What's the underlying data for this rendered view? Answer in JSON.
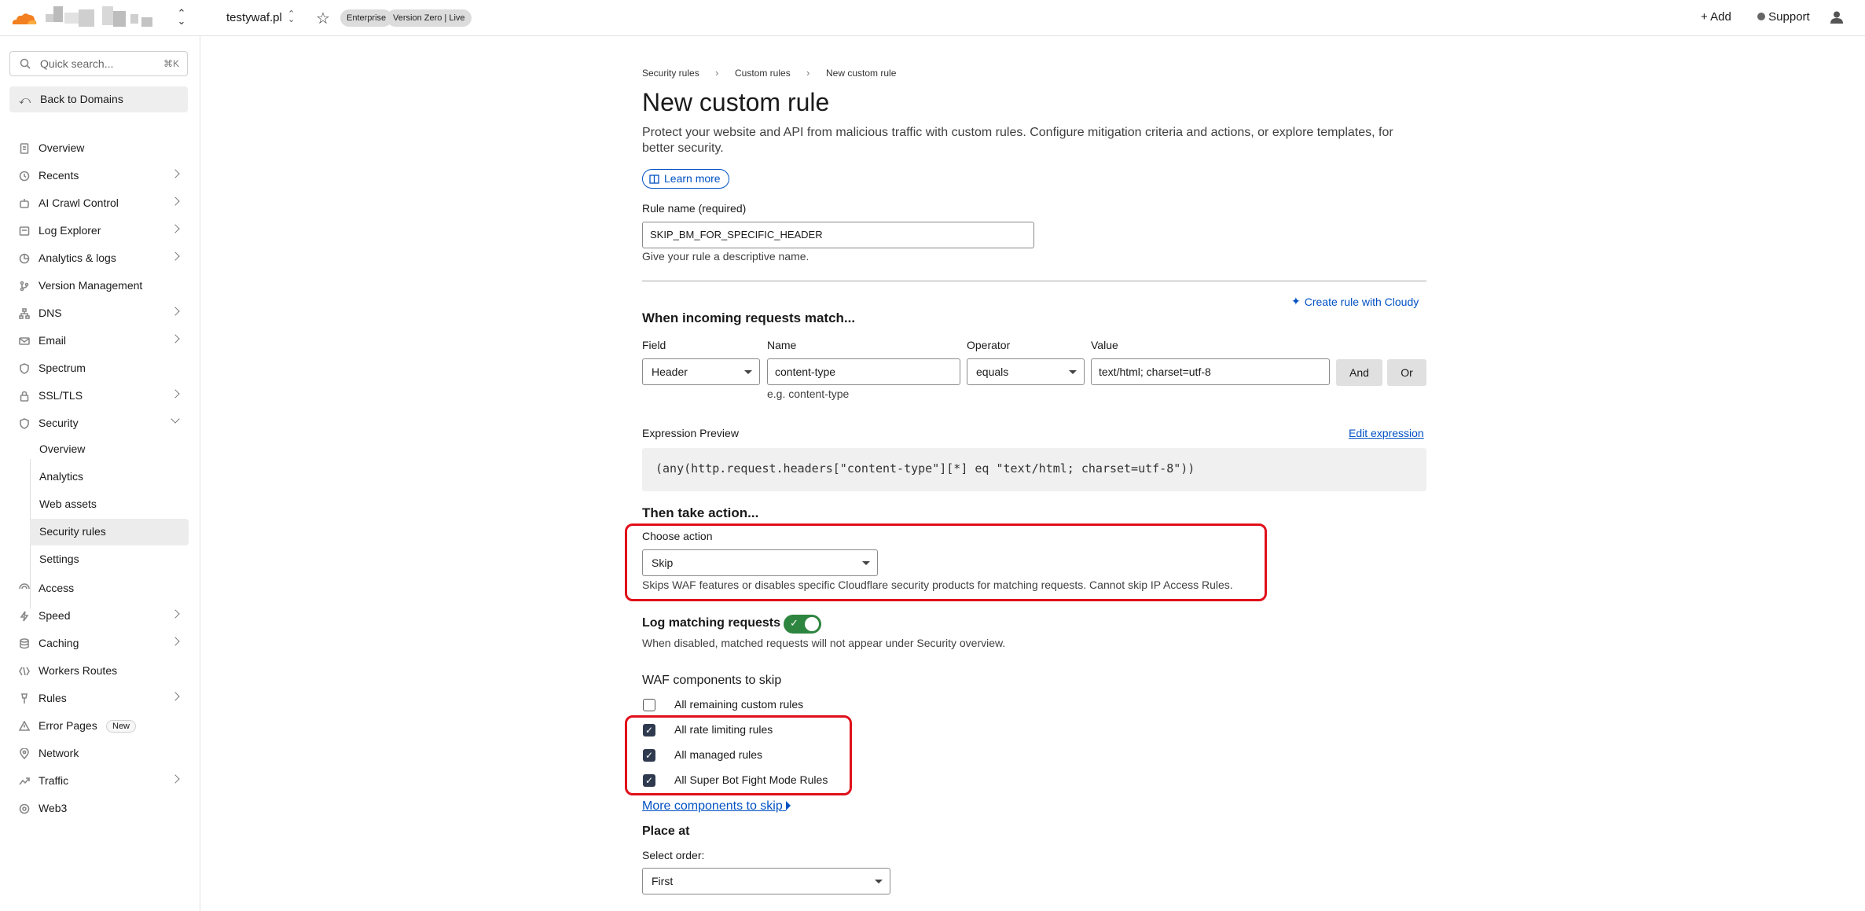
{
  "topbar": {
    "domain": "testywaf.pl",
    "badges": [
      "Enterprise",
      "Version Zero | Live"
    ],
    "add_label": "Add",
    "support_label": "Support",
    "brand_color": "#f38020"
  },
  "sidebar": {
    "search_placeholder": "Quick search...",
    "search_shortcut": "⌘K",
    "back_label": "Back to Domains",
    "items": [
      {
        "label": "Overview",
        "icon": "document-icon",
        "chevron": false
      },
      {
        "label": "Recents",
        "icon": "clock-icon",
        "chevron": true
      },
      {
        "label": "AI Crawl Control",
        "icon": "robot-icon",
        "chevron": true
      },
      {
        "label": "Log Explorer",
        "icon": "list-icon",
        "chevron": true
      },
      {
        "label": "Analytics & logs",
        "icon": "chart-icon",
        "chevron": true
      },
      {
        "label": "Version Management",
        "icon": "branch-icon",
        "chevron": false
      },
      {
        "label": "DNS",
        "icon": "network-icon",
        "chevron": true
      },
      {
        "label": "Email",
        "icon": "mail-icon",
        "chevron": true
      },
      {
        "label": "Spectrum",
        "icon": "shield-icon",
        "chevron": false
      },
      {
        "label": "SSL/TLS",
        "icon": "lock-icon",
        "chevron": true
      },
      {
        "label": "Security",
        "icon": "shield-icon",
        "chevron": true,
        "expanded": true
      }
    ],
    "security_sub": [
      "Overview",
      "Analytics",
      "Web assets",
      "Security rules",
      "Settings"
    ],
    "items_after": [
      {
        "label": "Access",
        "icon": "access-icon",
        "chevron": false
      },
      {
        "label": "Speed",
        "icon": "bolt-icon",
        "chevron": true
      },
      {
        "label": "Caching",
        "icon": "database-icon",
        "chevron": true
      },
      {
        "label": "Workers Routes",
        "icon": "workers-icon",
        "chevron": false
      },
      {
        "label": "Rules",
        "icon": "rules-icon",
        "chevron": true
      },
      {
        "label": "Error Pages",
        "icon": "warning-icon",
        "chevron": false,
        "badge": "New"
      },
      {
        "label": "Network",
        "icon": "pin-icon",
        "chevron": false
      },
      {
        "label": "Traffic",
        "icon": "traffic-icon",
        "chevron": true
      },
      {
        "label": "Web3",
        "icon": "web3-icon",
        "chevron": false
      }
    ]
  },
  "main": {
    "breadcrumb": [
      "Security rules",
      "Custom rules",
      "New custom rule"
    ],
    "title": "New custom rule",
    "description": "Protect your website and API from malicious traffic with custom rules. Configure mitigation criteria and actions, or explore templates, for better security.",
    "learn_more": "Learn more",
    "rule_name_label": "Rule name (required)",
    "rule_name_value": "SKIP_BM_FOR_SPECIFIC_HEADER",
    "rule_name_hint": "Give your rule a descriptive name.",
    "create_cloudy": "Create rule with Cloudy",
    "match_heading": "When incoming requests match...",
    "field_label": "Field",
    "field_value": "Header",
    "name_label": "Name",
    "name_value": "content-type",
    "name_hint": "e.g. content-type",
    "operator_label": "Operator",
    "operator_value": "equals",
    "value_label": "Value",
    "value_value": "text/html; charset=utf-8",
    "and_label": "And",
    "or_label": "Or",
    "expr_label": "Expression Preview",
    "edit_expr": "Edit expression",
    "expression": "(any(http.request.headers[\"content-type\"][*] eq \"text/html; charset=utf-8\"))",
    "action_heading": "Then take action...",
    "choose_action_label": "Choose action",
    "action_value": "Skip",
    "action_hint": "Skips WAF features or disables specific Cloudflare security products for matching requests. Cannot skip IP Access Rules.",
    "log_label": "Log matching requests",
    "log_enabled": true,
    "log_hint": "When disabled, matched requests will not appear under Security overview.",
    "waf_heading": "WAF components to skip",
    "components": [
      {
        "label": "All remaining custom rules",
        "checked": false
      },
      {
        "label": "All rate limiting rules",
        "checked": true
      },
      {
        "label": "All managed rules",
        "checked": true
      },
      {
        "label": "All Super Bot Fight Mode Rules",
        "checked": true
      }
    ],
    "more_components": "More components to skip",
    "place_heading": "Place at",
    "order_label": "Select order:",
    "order_value": "First",
    "highlight_color": "#e0101a"
  }
}
